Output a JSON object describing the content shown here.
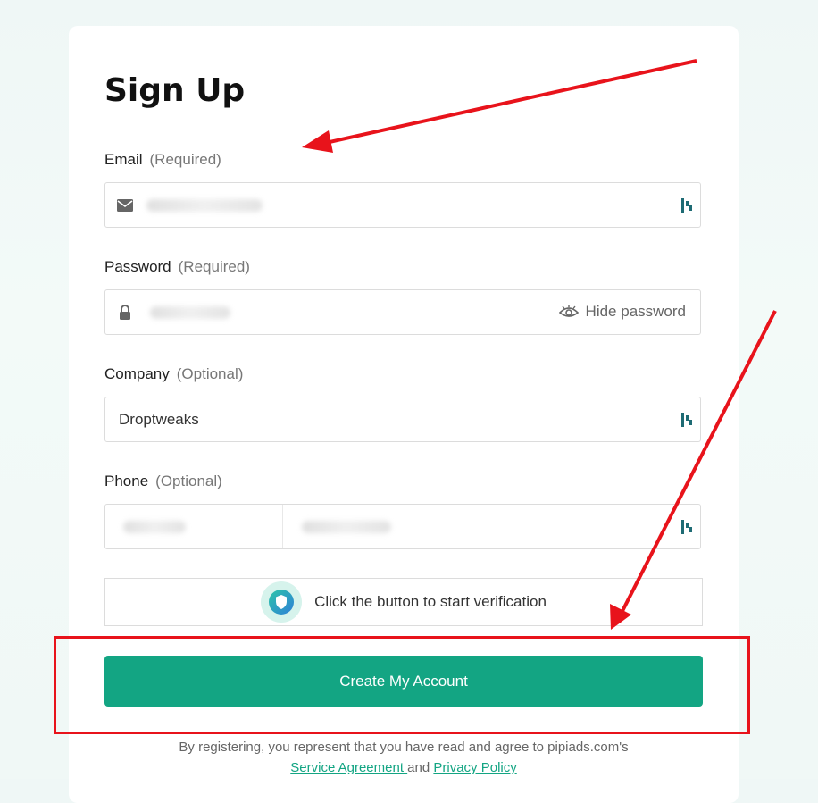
{
  "form": {
    "title": "Sign Up",
    "email": {
      "label": "Email",
      "hint": "(Required)",
      "icon": "mail-icon"
    },
    "password": {
      "label": "Password",
      "hint": "(Required)",
      "icon": "lock-icon",
      "toggle_label": "Hide password",
      "toggle_icon": "eye-icon"
    },
    "company": {
      "label": "Company",
      "hint": "(Optional)",
      "value": "Droptweaks"
    },
    "phone": {
      "label": "Phone",
      "hint": "(Optional)"
    },
    "verification": {
      "text": "Click the button to start verification",
      "icon": "shield-icon"
    },
    "submit_label": "Create My Account",
    "legal": {
      "prefix": "By registering, you represent that you have read and agree to pipiads.com's",
      "service_link": "Service Agreement ",
      "connector": "and",
      "privacy_link": "Privacy Policy"
    }
  },
  "colors": {
    "accent": "#13a583",
    "annotation": "#e8131b"
  }
}
